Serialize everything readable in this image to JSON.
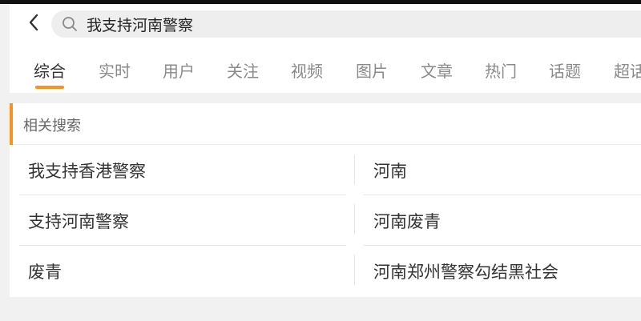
{
  "search": {
    "query": "我支持河南警察"
  },
  "tabs": [
    {
      "label": "综合",
      "active": true
    },
    {
      "label": "实时",
      "active": false
    },
    {
      "label": "用户",
      "active": false
    },
    {
      "label": "关注",
      "active": false
    },
    {
      "label": "视频",
      "active": false
    },
    {
      "label": "图片",
      "active": false
    },
    {
      "label": "文章",
      "active": false
    },
    {
      "label": "热门",
      "active": false
    },
    {
      "label": "话题",
      "active": false
    },
    {
      "label": "超话",
      "active": false
    }
  ],
  "related": {
    "title": "相关搜索",
    "items": [
      "我支持香港警察",
      "河南",
      "支持河南警察",
      "河南废青",
      "废青",
      "河南郑州警察勾结黑社会"
    ]
  },
  "colors": {
    "accent": "#f7931e",
    "active_tab_text": "#333333",
    "inactive_tab_text": "#8a8a8a"
  }
}
